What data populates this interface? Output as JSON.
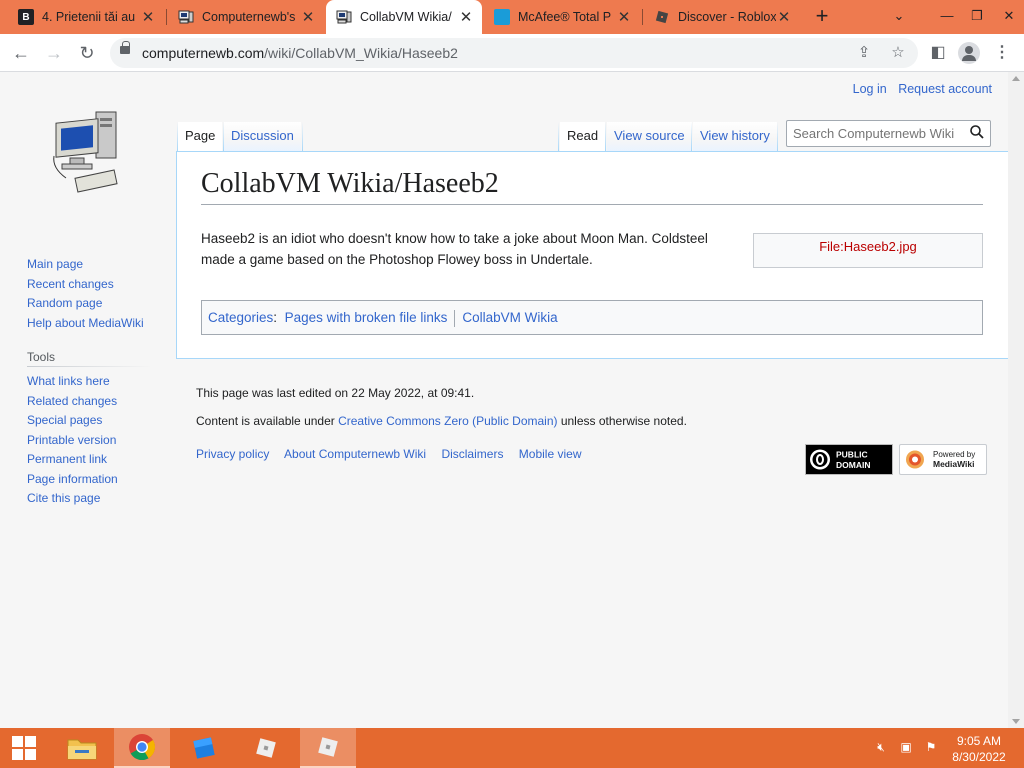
{
  "browser": {
    "tabs": [
      {
        "title": "4. Prietenii tăi au",
        "favicon": "B"
      },
      {
        "title": "Computernewb's",
        "favicon": "computer"
      },
      {
        "title": "CollabVM Wikia/",
        "favicon": "computer",
        "active": true
      },
      {
        "title": "McAfee® Total P",
        "favicon": "mcafee"
      },
      {
        "title": "Discover - Roblox",
        "favicon": "roblox"
      }
    ],
    "url_domain": "computernewb.com",
    "url_path": "/wiki/CollabVM_Wikia/Haseeb2"
  },
  "wiki": {
    "personal": {
      "login": "Log in",
      "request": "Request account"
    },
    "nav": [
      "Main page",
      "Recent changes",
      "Random page",
      "Help about MediaWiki"
    ],
    "tools_heading": "Tools",
    "tools": [
      "What links here",
      "Related changes",
      "Special pages",
      "Printable version",
      "Permanent link",
      "Page information",
      "Cite this page"
    ],
    "tabs": {
      "page": "Page",
      "discussion": "Discussion",
      "read": "Read",
      "view_source": "View source",
      "view_history": "View history"
    },
    "search_placeholder": "Search Computernewb Wiki",
    "title": "CollabVM Wikia/Haseeb2",
    "body": "Haseeb2 is an idiot who doesn't know how to take a joke about Moon Man. Coldsteel made a game based on the Photoshop Flowey boss in Undertale.",
    "file_link": "File:Haseeb2.jpg",
    "categories_label": "Categories",
    "categories": [
      "Pages with broken file links",
      "CollabVM Wikia"
    ],
    "footer": {
      "last_edited": "This page was last edited on 22 May 2022, at 09:41.",
      "license_prefix": "Content is available under ",
      "license_link": "Creative Commons Zero (Public Domain)",
      "license_suffix": " unless otherwise noted.",
      "places": [
        "Privacy policy",
        "About Computernewb Wiki",
        "Disclaimers",
        "Mobile view"
      ],
      "badge_pd_line1": "PUBLIC",
      "badge_pd_line2": "DOMAIN",
      "badge_mw_line1": "Powered by",
      "badge_mw_line2": "MediaWiki"
    }
  },
  "taskbar": {
    "time": "9:05 AM",
    "date": "8/30/2022"
  },
  "colors": {
    "tabstrip": "#ee7a4f",
    "taskbar": "#e4692f",
    "link": "#36c",
    "redlink": "#ba0000"
  }
}
